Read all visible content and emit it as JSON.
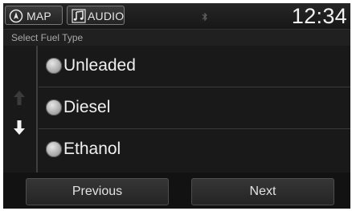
{
  "status_bar": {
    "map_label": "MAP",
    "audio_label": "AUDIO",
    "time": "12:34",
    "icons": {
      "map": "compass-icon",
      "audio": "music-note-icon",
      "bluetooth": "bluetooth-icon"
    }
  },
  "header": {
    "title": "Select Fuel Type"
  },
  "scroll": {
    "up_icon": "arrow-up-icon",
    "down_icon": "arrow-down-icon"
  },
  "options": [
    {
      "label": "Unleaded"
    },
    {
      "label": "Diesel"
    },
    {
      "label": "Ethanol"
    }
  ],
  "buttons": {
    "previous": "Previous",
    "next": "Next"
  }
}
